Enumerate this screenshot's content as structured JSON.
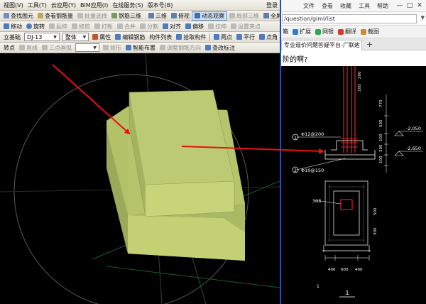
{
  "cad": {
    "menu": [
      "视图(V)",
      "工具(T)",
      "云应用(Y)",
      "BIM应用(I)",
      "在线服务(S)",
      "版本号(B)",
      "登录"
    ],
    "toolbar2": {
      "find_element": "查找图元",
      "view_rebar": "查看钢筋量",
      "batch_select": "批量选择",
      "rebar_3d": "钢筋三维",
      "view_3d": "三维",
      "top_view": "俯视",
      "dynamic_view": "动态观察",
      "local_3d": "局部三维",
      "fullscreen": "全屏"
    },
    "toolbar3": {
      "move": "移动",
      "rotate": "旋转",
      "extend": "延伸",
      "trim": "修剪",
      "break": "打断",
      "merge": "合并",
      "split": "分割",
      "align": "对齐",
      "offset": "偏移",
      "stretch": "拉伸",
      "set_point": "设置夹点"
    },
    "toolbar4": {
      "element_type": "立基础",
      "element_name": "DJ-13",
      "scope": "整体",
      "properties": "属性",
      "edit_rebar": "编辑钢筋",
      "element_list": "构件列表",
      "pick_element": "拾取构件",
      "two_points": "两点",
      "parallel": "平行",
      "point_angle": "点角"
    },
    "toolbar5": {
      "snap_point": "转点",
      "line": "直线",
      "three_point_arc": "三点画弧",
      "rectangle": "矩形",
      "smart_layout": "智能布置",
      "adjust_direction": "调整钢筋方向",
      "change_label": "查改标注"
    }
  },
  "browser": {
    "menu": [
      "文件",
      "查看",
      "收藏",
      "工具",
      "帮助"
    ],
    "window_controls": [
      "—",
      "□",
      "✕"
    ],
    "address": "/question/giml/list",
    "bookmarks": [
      "箱",
      "扩展",
      "网银",
      "翻译",
      "截图"
    ],
    "tab_title": "专业造价问题答疑平台-广联达",
    "question_text": "阶的啊?",
    "drawing": {
      "labels": {
        "bar_top": "Φ12@200",
        "bar_bottom": "Φ10@150",
        "elev_top": "-2.050",
        "elev_bottom": "-2.650",
        "bubble_1": "1",
        "bubble_2": "2",
        "section": "1",
        "dim_side_1": "770",
        "dim_side_2": "500",
        "dim_side_3": "100",
        "dim_side_4": "300",
        "dim_side_5": "100",
        "dim_top_1": "200",
        "dim_top_2": "100",
        "dim_bot_1": "400",
        "dim_bot_2": "600",
        "dim_bot_3": "400",
        "dim_right_1": "500",
        "dim_right_2": "300",
        "mark": "3Φ8",
        "lower_label": "1"
      }
    }
  },
  "colors": {
    "cad_bg": "#000000",
    "footing": "#b5c46a",
    "arrow": "#e81010",
    "toolbar_bg": "#ebe8e0"
  }
}
